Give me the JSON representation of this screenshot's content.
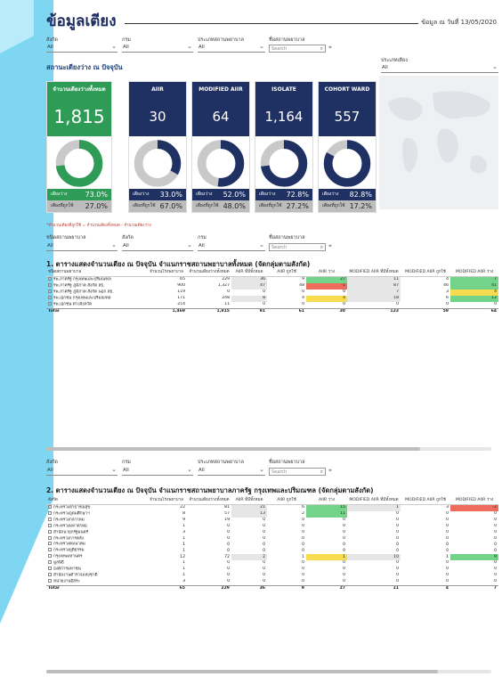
{
  "header": {
    "title": "ข้อมูลเตียง",
    "asof_label": "ข้อมูล ณ วันที่",
    "asof_date": "13/05/2020"
  },
  "filters_top": {
    "labels": [
      "สังกัด",
      "กรม",
      "ประเภทสถานพยาบาล",
      "ชื่อสถานพยาบาล"
    ],
    "values": [
      "All",
      "All",
      "All"
    ],
    "search_placeholder": "Search"
  },
  "subtitle": "สถานะเตียงว่าง ณ ปัจจุบัน",
  "bed_type": {
    "label": "ประเภทเตียง",
    "value": "All"
  },
  "cards": [
    {
      "title": "จำนวนเตียงว่างทั้งหมด",
      "value": "1,815",
      "free_label": "เตียงว่าง",
      "free_pct": "73.0%",
      "used_label": "เตียงที่ถูกใช้",
      "used_pct": "27.0%",
      "free_frac": 0.73,
      "color": "#2e9b57"
    },
    {
      "title": "AIIR",
      "value": "30",
      "free_label": "เตียงว่าง",
      "free_pct": "33.0%",
      "used_label": "เตียงที่ถูกใช้",
      "used_pct": "67.0%",
      "free_frac": 0.33,
      "color": "#1f3063"
    },
    {
      "title": "MODIFIED AIIR",
      "value": "64",
      "free_label": "เตียงว่าง",
      "free_pct": "52.0%",
      "used_label": "เตียงที่ถูกใช้",
      "used_pct": "48.0%",
      "free_frac": 0.52,
      "color": "#1f3063"
    },
    {
      "title": "ISOLATE",
      "value": "1,164",
      "free_label": "เตียงว่าง",
      "free_pct": "72.8%",
      "used_label": "เตียงที่ถูกใช้",
      "used_pct": "27.2%",
      "free_frac": 0.728,
      "color": "#1f3063"
    },
    {
      "title": "COHORT WARD",
      "value": "557",
      "free_label": "เตียงว่าง",
      "free_pct": "82.8%",
      "used_label": "เตียงที่ถูกใช้",
      "used_pct": "17.2%",
      "free_frac": 0.828,
      "color": "#1f3063"
    }
  ],
  "note": "*จำนวนเตียงที่ถูกใช้ = จำนวนเตียงทั้งหมด - จำนวนเตียงว่าง",
  "filters_mid": {
    "labels": [
      "ชนิดสถานพยาบาล",
      "สังกัด",
      "กรม",
      "ชื่อสถานพยาบาล"
    ],
    "values": [
      "All",
      "All",
      "All"
    ],
    "search_placeholder": "Search"
  },
  "table1": {
    "title": "1. ตารางแสดงจำนวนเตียง ณ ปัจจุบัน จำแนกราชสถานพยาบาลทั้งหมด (จัดกลุ่มตามสังกัด)",
    "headers": [
      "ชนิดสถานพยาบาล",
      "จำนวนโรงพยาบาล",
      "จำนวนเตียงว่างทั้งหมด",
      "AIIR ที่มีทั้งหมด",
      "AIIR ถูกใช้",
      "AIIR ว่าง",
      "MODIFIED AIIR ที่มีทั้งหมด",
      "MODIFIED AIIR ถูกใช้",
      "MODIFIED AIIR ว่าง"
    ],
    "rows": [
      {
        "name": "รพ.ภาครัฐ กรุงเทพและปริมณฑล",
        "v": [
          "65",
          "229",
          "36",
          "9",
          "27",
          "11",
          "4",
          "7"
        ]
      },
      {
        "name": "รพ.ภาครัฐ ภูมิภาค สังกัด สธ.",
        "v": [
          "900",
          "1,327",
          "47",
          "48",
          "-1",
          "87",
          "46",
          "41"
        ]
      },
      {
        "name": "รพ.ภาครัฐ ภูมิภาค สังกัด นอก สธ.",
        "v": [
          "119",
          "0",
          "0",
          "0",
          "0",
          "7",
          "3",
          "4"
        ]
      },
      {
        "name": "รพ.เอกชน กรุงเทพและปริมณฑล",
        "v": [
          "171",
          "248",
          "8",
          "4",
          "4",
          "18",
          "6",
          "12"
        ]
      },
      {
        "name": "รพ.เอกชน ต่างจังหวัด",
        "v": [
          "214",
          "11",
          "0",
          "0",
          "0",
          "0",
          "0",
          "0"
        ]
      }
    ],
    "total": {
      "name": "Total",
      "v": [
        "1,469",
        "1,815",
        "91",
        "61",
        "30",
        "123",
        "59",
        "64"
      ]
    }
  },
  "filters_low": {
    "labels": [
      "สังกัด",
      "กรม",
      "ประเภทสถานพยาบาล",
      "ชื่อสถานพยาบาล"
    ],
    "values": [
      "All",
      "All",
      "All"
    ],
    "search_placeholder": "Search"
  },
  "table2": {
    "title": "2. ตารางแสดงจำนวนเตียง ณ ปัจจุบัน จำแนกราชสถานพยาบาลภาครัฐ กรุงเทพและปริมณฑล (จัดกลุ่มตามสังกัด)",
    "headers": [
      "สังกัด",
      "จำนวนโรงพยาบาล",
      "จำนวนเตียงว่างทั้งหมด",
      "AIIR ที่มีทั้งหมด",
      "AIIR ถูกใช้",
      "AIIR ว่าง",
      "MODIFIED AIIR ที่มีทั้งหมด",
      "MODIFIED AIIR ถูกใช้",
      "MODIFIED AIIR ว่าง"
    ],
    "rows": [
      {
        "name": "กระทรวงสาธารณสุข",
        "v": [
          "22",
          "81",
          "21",
          "6",
          "15",
          "1",
          "3",
          "-2"
        ]
      },
      {
        "name": "กระทรวงอุดมศึกษาฯ",
        "v": [
          "8",
          "57",
          "13",
          "2",
          "11",
          "0",
          "0",
          "0"
        ]
      },
      {
        "name": "กระทรวงกลาโหม",
        "v": [
          "9",
          "19",
          "0",
          "0",
          "0",
          "0",
          "0",
          "0"
        ]
      },
      {
        "name": "กระทรวงมหาดไทย",
        "v": [
          "1",
          "0",
          "0",
          "0",
          "0",
          "0",
          "0",
          "0"
        ]
      },
      {
        "name": "สำนักนายกรัฐมนตรี",
        "v": [
          "3",
          "0",
          "0",
          "0",
          "0",
          "0",
          "0",
          "0"
        ]
      },
      {
        "name": "กระทรวงการคลัง",
        "v": [
          "1",
          "0",
          "0",
          "0",
          "0",
          "0",
          "0",
          "0"
        ]
      },
      {
        "name": "กระทรวงคมนาคม",
        "v": [
          "1",
          "0",
          "0",
          "0",
          "0",
          "0",
          "0",
          "0"
        ]
      },
      {
        "name": "กระทรวงยุติธรรม",
        "v": [
          "1",
          "0",
          "0",
          "0",
          "0",
          "0",
          "0",
          "0"
        ]
      },
      {
        "name": "กรุงเทพมหานคร",
        "v": [
          "12",
          "72",
          "2",
          "1",
          "1",
          "10",
          "1",
          "9"
        ]
      },
      {
        "name": "มูลนิธิ",
        "v": [
          "1",
          "0",
          "0",
          "0",
          "0",
          "0",
          "0",
          "0"
        ]
      },
      {
        "name": "องค์การมหาชน",
        "v": [
          "1",
          "0",
          "0",
          "0",
          "0",
          "0",
          "0",
          "0"
        ]
      },
      {
        "name": "สำนักงานตำรวจแห่งชาติ",
        "v": [
          "1",
          "0",
          "0",
          "0",
          "0",
          "0",
          "0",
          "0"
        ]
      },
      {
        "name": "หน่วยงานอิสระ",
        "v": [
          "3",
          "0",
          "0",
          "0",
          "0",
          "0",
          "0",
          "0"
        ]
      }
    ],
    "total": {
      "name": "Total",
      "v": [
        "65",
        "229",
        "36",
        "9",
        "27",
        "11",
        "4",
        "7"
      ]
    }
  }
}
